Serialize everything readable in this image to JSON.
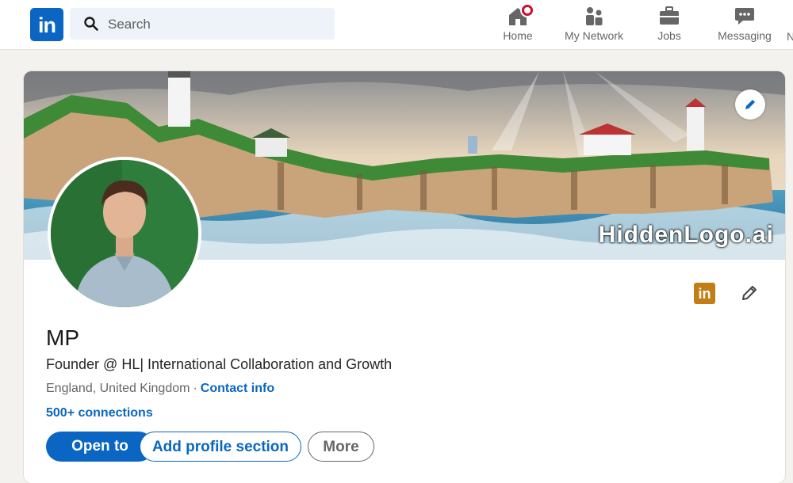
{
  "nav": {
    "logo_text": "in",
    "search_placeholder": "Search",
    "items": [
      {
        "label": "Home",
        "icon": "home-icon",
        "has_badge": true
      },
      {
        "label": "My Network",
        "icon": "people-icon"
      },
      {
        "label": "Jobs",
        "icon": "briefcase-icon"
      },
      {
        "label": "Messaging",
        "icon": "chat-icon"
      }
    ],
    "clipped_item": "N"
  },
  "banner": {
    "watermark": "HiddenLogo.ai",
    "edit_icon": "pencil-icon"
  },
  "profile": {
    "name": "MP",
    "headline": "Founder @ HL| International Collaboration and Growth",
    "location": "England, United Kingdom",
    "separator": "·",
    "contact_info": "Contact info",
    "connections": "500+ connections",
    "linkedin_badge": "in"
  },
  "actions": {
    "open_to": "Open to",
    "add_section": "Add profile section",
    "more": "More"
  },
  "colors": {
    "brand": "#0a66c2",
    "badge": "#cb112d",
    "premium_badge": "#c37d16"
  }
}
